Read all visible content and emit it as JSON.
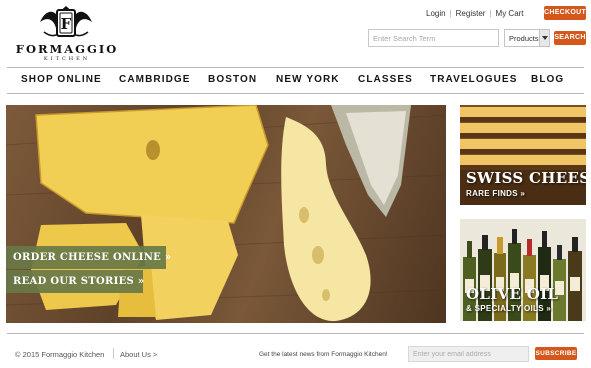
{
  "brand": {
    "name": "FORMAGGIO",
    "tagline": "KITCHEN",
    "crest_letter": "F"
  },
  "utility": {
    "login": "Login",
    "register": "Register",
    "cart": "My Cart",
    "checkout": "CHECKOUT"
  },
  "search": {
    "placeholder": "Enter Search Term",
    "scope": "Products",
    "button": "SEARCH"
  },
  "nav": [
    "SHOP ONLINE",
    "CAMBRIDGE",
    "BOSTON",
    "NEW YORK",
    "CLASSES",
    "TRAVELOGUES",
    "BLOG"
  ],
  "hero": {
    "cta_primary": "ORDER CHEESE ONLINE »",
    "cta_secondary": "READ OUR STORIES »"
  },
  "promos": {
    "swiss": {
      "title": "SWISS CHEESE",
      "subtitle": "RARE FINDS »"
    },
    "oil": {
      "title": "OLIVE OIL",
      "subtitle": "& SPECIALTY OILS »"
    }
  },
  "footer": {
    "copyright": "© 2015 Formaggio Kitchen",
    "about": "About Us >",
    "newsletter_prompt": "Get the latest news from Formaggio Kitchen!",
    "email_placeholder": "Enter your email address",
    "subscribe": "SUBSCRIBE"
  },
  "colors": {
    "accent": "#d4581c",
    "hero_label": "#687846",
    "rule": "#b8b8b8"
  }
}
